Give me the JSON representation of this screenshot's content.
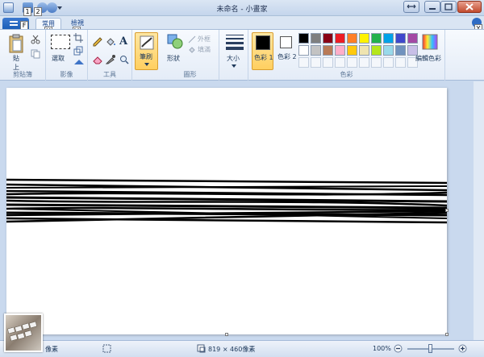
{
  "window": {
    "title": "未命名 - 小畫家"
  },
  "keytips": {
    "file": "F",
    "qat1": "1",
    "qat2": "2",
    "home": "H",
    "view": "V",
    "help": "Y"
  },
  "tabs": [
    {
      "label": "常用",
      "active": true
    },
    {
      "label": "檢視",
      "active": false
    }
  ],
  "ribbon": {
    "clipboard": {
      "group": "剪貼簿",
      "paste": "貼",
      "paste_sub": "上"
    },
    "image": {
      "group": "影像",
      "select": "選取"
    },
    "tools": {
      "group": "工具"
    },
    "brushes": {
      "label": "筆刷"
    },
    "shapes": {
      "group": "圖形",
      "shapes_label": "形狀",
      "outline": "外框",
      "fill": "填滿"
    },
    "size": {
      "label": "大小"
    },
    "colors": {
      "group": "色彩",
      "color1": "色彩 1",
      "color2": "色彩 2",
      "edit": "編輯色彩",
      "color1_value": "#000000",
      "color2_value": "#ffffff",
      "palette": [
        "#000000",
        "#7f7f7f",
        "#880015",
        "#ed1c24",
        "#ff7f27",
        "#fff200",
        "#22b14c",
        "#00a2e8",
        "#3f48cc",
        "#a349a4",
        "#ffffff",
        "#c3c3c3",
        "#b97a57",
        "#ffaec9",
        "#ffc90e",
        "#efe4b0",
        "#b5e61d",
        "#99d9ea",
        "#7092be",
        "#c8bfe7"
      ]
    }
  },
  "statusbar": {
    "dimensions": "819 × 460像素",
    "zoom": "100%",
    "left_text": "像素",
    "zoom_level": 0.5
  }
}
